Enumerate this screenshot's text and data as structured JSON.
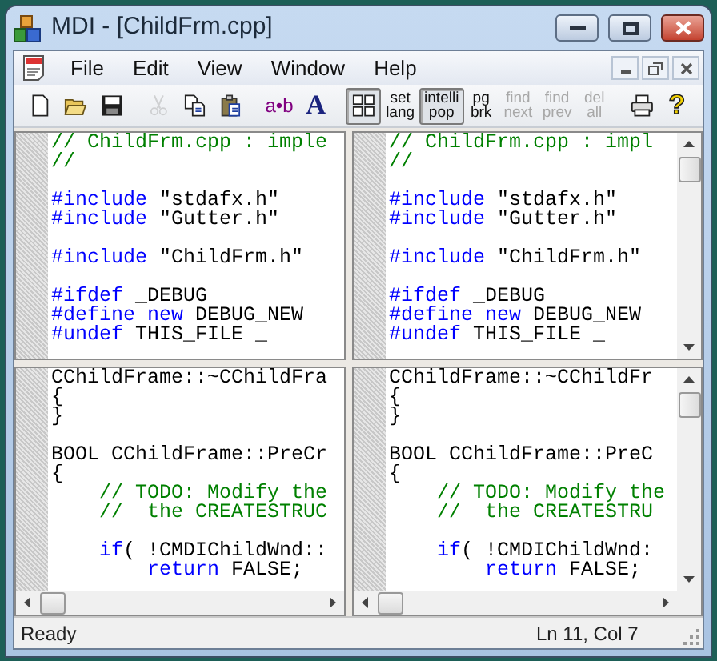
{
  "window": {
    "title": "MDI - [ChildFrm.cpp]"
  },
  "menu": [
    {
      "label": "File"
    },
    {
      "label": "Edit"
    },
    {
      "label": "View"
    },
    {
      "label": "Window"
    },
    {
      "label": "Help"
    }
  ],
  "toolbar": [
    {
      "kind": "icon",
      "disabled": false,
      "pressed": false
    },
    {
      "kind": "icon",
      "disabled": false,
      "pressed": false
    },
    {
      "kind": "icon",
      "disabled": false,
      "pressed": false
    },
    {
      "kind": "icon",
      "disabled": true,
      "pressed": false
    },
    {
      "kind": "icon",
      "disabled": false,
      "pressed": false
    },
    {
      "kind": "icon",
      "disabled": false,
      "pressed": false
    },
    {
      "kind": "glyph",
      "label": "a•b",
      "color": "#800080",
      "disabled": false,
      "pressed": false
    },
    {
      "kind": "letter",
      "label": "A",
      "color": "#1a237e",
      "disabled": false,
      "pressed": false
    },
    {
      "kind": "icon",
      "disabled": false,
      "pressed": true
    },
    {
      "kind": "text",
      "lines": [
        "set",
        "lang"
      ],
      "disabled": false,
      "pressed": false
    },
    {
      "kind": "text",
      "lines": [
        "intelli",
        "pop"
      ],
      "disabled": false,
      "pressed": true
    },
    {
      "kind": "text",
      "lines": [
        "pg",
        "brk"
      ],
      "disabled": false,
      "pressed": false
    },
    {
      "kind": "text",
      "lines": [
        "find",
        "next"
      ],
      "disabled": true,
      "pressed": false
    },
    {
      "kind": "text",
      "lines": [
        "find",
        "prev"
      ],
      "disabled": true,
      "pressed": false
    },
    {
      "kind": "text",
      "lines": [
        "del",
        "all"
      ],
      "disabled": true,
      "pressed": false
    },
    {
      "kind": "icon",
      "disabled": false,
      "pressed": false
    },
    {
      "kind": "help",
      "label": "?",
      "color": "#f2d000",
      "disabled": false,
      "pressed": false
    }
  ],
  "panes": [
    {
      "lines": [
        {
          "gap_before": false,
          "segments": [
            {
              "kind": "comment",
              "text": "// ChildFrm.cpp : imple"
            }
          ]
        },
        {
          "gap_before": false,
          "segments": [
            {
              "kind": "comment",
              "text": "//"
            }
          ]
        },
        {
          "gap_before": true,
          "segments": [
            {
              "kind": "keyword",
              "text": "#include"
            },
            {
              "kind": "plain",
              "text": " \"stdafx.h\""
            }
          ]
        },
        {
          "gap_before": false,
          "segments": [
            {
              "kind": "keyword",
              "text": "#include"
            },
            {
              "kind": "plain",
              "text": " \"Gutter.h\""
            }
          ]
        },
        {
          "gap_before": true,
          "segments": [
            {
              "kind": "keyword",
              "text": "#include"
            },
            {
              "kind": "plain",
              "text": " \"ChildFrm.h\""
            }
          ]
        },
        {
          "gap_before": true,
          "segments": [
            {
              "kind": "keyword",
              "text": "#ifdef"
            },
            {
              "kind": "plain",
              "text": " _DEBUG"
            }
          ]
        },
        {
          "gap_before": false,
          "segments": [
            {
              "kind": "keyword",
              "text": "#define new"
            },
            {
              "kind": "plain",
              "text": " DEBUG_NEW"
            }
          ]
        },
        {
          "gap_before": false,
          "segments": [
            {
              "kind": "keyword",
              "text": "#undef"
            },
            {
              "kind": "plain",
              "text": " THIS_FILE _"
            }
          ]
        }
      ]
    },
    {
      "lines": [
        {
          "gap_before": false,
          "segments": [
            {
              "kind": "comment",
              "text": "// ChildFrm.cpp : impl"
            }
          ]
        },
        {
          "gap_before": false,
          "segments": [
            {
              "kind": "comment",
              "text": "//"
            }
          ]
        },
        {
          "gap_before": true,
          "segments": [
            {
              "kind": "keyword",
              "text": "#include"
            },
            {
              "kind": "plain",
              "text": " \"stdafx.h\""
            }
          ]
        },
        {
          "gap_before": false,
          "segments": [
            {
              "kind": "keyword",
              "text": "#include"
            },
            {
              "kind": "plain",
              "text": " \"Gutter.h\""
            }
          ]
        },
        {
          "gap_before": true,
          "segments": [
            {
              "kind": "keyword",
              "text": "#include"
            },
            {
              "kind": "plain",
              "text": " \"ChildFrm.h\""
            }
          ]
        },
        {
          "gap_before": true,
          "segments": [
            {
              "kind": "keyword",
              "text": "#ifdef"
            },
            {
              "kind": "plain",
              "text": " _DEBUG"
            }
          ]
        },
        {
          "gap_before": false,
          "segments": [
            {
              "kind": "keyword",
              "text": "#define new"
            },
            {
              "kind": "plain",
              "text": " DEBUG_NEW"
            }
          ]
        },
        {
          "gap_before": false,
          "segments": [
            {
              "kind": "keyword",
              "text": "#undef"
            },
            {
              "kind": "plain",
              "text": " THIS_FILE _"
            }
          ]
        }
      ]
    },
    {
      "lines": [
        {
          "gap_before": false,
          "segments": [
            {
              "kind": "plain",
              "text": "CChildFrame::~CChildFra"
            }
          ]
        },
        {
          "gap_before": false,
          "segments": [
            {
              "kind": "plain",
              "text": "{"
            }
          ]
        },
        {
          "gap_before": false,
          "segments": [
            {
              "kind": "plain",
              "text": "}"
            }
          ]
        },
        {
          "gap_before": true,
          "segments": [
            {
              "kind": "plain",
              "text": "BOOL CChildFrame::PreCr"
            }
          ]
        },
        {
          "gap_before": false,
          "segments": [
            {
              "kind": "plain",
              "text": "{"
            }
          ]
        },
        {
          "gap_before": false,
          "segments": [
            {
              "kind": "comment",
              "text": "    // TODO: Modify the"
            }
          ]
        },
        {
          "gap_before": false,
          "segments": [
            {
              "kind": "comment",
              "text": "    //  the CREATESTRUC"
            }
          ]
        },
        {
          "gap_before": true,
          "segments": [
            {
              "kind": "keyword",
              "text": "    if"
            },
            {
              "kind": "plain",
              "text": "( !CMDIChildWnd::"
            }
          ]
        },
        {
          "gap_before": false,
          "segments": [
            {
              "kind": "keyword",
              "text": "        return"
            },
            {
              "kind": "plain",
              "text": " FALSE;"
            }
          ]
        }
      ]
    },
    {
      "lines": [
        {
          "gap_before": false,
          "segments": [
            {
              "kind": "plain",
              "text": "CChildFrame::~CChildFr"
            }
          ]
        },
        {
          "gap_before": false,
          "segments": [
            {
              "kind": "plain",
              "text": "{"
            }
          ]
        },
        {
          "gap_before": false,
          "segments": [
            {
              "kind": "plain",
              "text": "}"
            }
          ]
        },
        {
          "gap_before": true,
          "segments": [
            {
              "kind": "plain",
              "text": "BOOL CChildFrame::PreC"
            }
          ]
        },
        {
          "gap_before": false,
          "segments": [
            {
              "kind": "plain",
              "text": "{"
            }
          ]
        },
        {
          "gap_before": false,
          "segments": [
            {
              "kind": "comment",
              "text": "    // TODO: Modify the"
            }
          ]
        },
        {
          "gap_before": false,
          "segments": [
            {
              "kind": "comment",
              "text": "    //  the CREATESTRU"
            }
          ]
        },
        {
          "gap_before": true,
          "segments": [
            {
              "kind": "keyword",
              "text": "    if"
            },
            {
              "kind": "plain",
              "text": "( !CMDIChildWnd:"
            }
          ]
        },
        {
          "gap_before": false,
          "segments": [
            {
              "kind": "keyword",
              "text": "        return"
            },
            {
              "kind": "plain",
              "text": " FALSE;"
            }
          ]
        }
      ]
    }
  ],
  "status_bar": {
    "message": "Ready",
    "position": "Ln 11, Col 7"
  }
}
